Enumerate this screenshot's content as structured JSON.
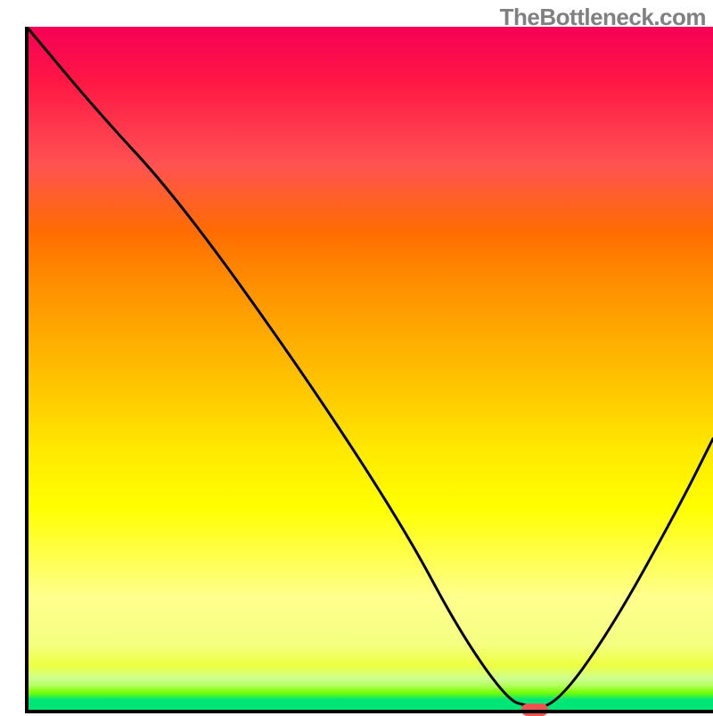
{
  "watermark": "TheBottleneck.com",
  "chart_data": {
    "type": "line",
    "title": "",
    "xlabel": "",
    "ylabel": "",
    "xlim": [
      0,
      100
    ],
    "ylim": [
      0,
      100
    ],
    "grid": false,
    "legend": false,
    "series": [
      {
        "name": "bottleneck-curve",
        "x": [
          0,
          10,
          22,
          40,
          55,
          63,
          70,
          73,
          77,
          85,
          95,
          100
        ],
        "values": [
          100,
          88,
          75,
          50,
          27,
          12,
          2,
          1,
          1,
          12,
          30,
          40
        ]
      }
    ],
    "annotations": [
      {
        "name": "optimal-marker",
        "x": 74,
        "y": 0.5,
        "color": "#EF5350"
      }
    ],
    "background": {
      "type": "vertical-linear-gradient",
      "stops": [
        {
          "pos": 0,
          "color": "#00E676"
        },
        {
          "pos": 3,
          "color": "#76FF03"
        },
        {
          "pos": 7,
          "color": "#EEFF41"
        },
        {
          "pos": 17,
          "color": "#FFFF8D"
        },
        {
          "pos": 30,
          "color": "#FFFF00"
        },
        {
          "pos": 48,
          "color": "#FFC400"
        },
        {
          "pos": 62,
          "color": "#FF9100"
        },
        {
          "pos": 80,
          "color": "#FF5252"
        },
        {
          "pos": 100,
          "color": "#F50057"
        }
      ]
    }
  }
}
